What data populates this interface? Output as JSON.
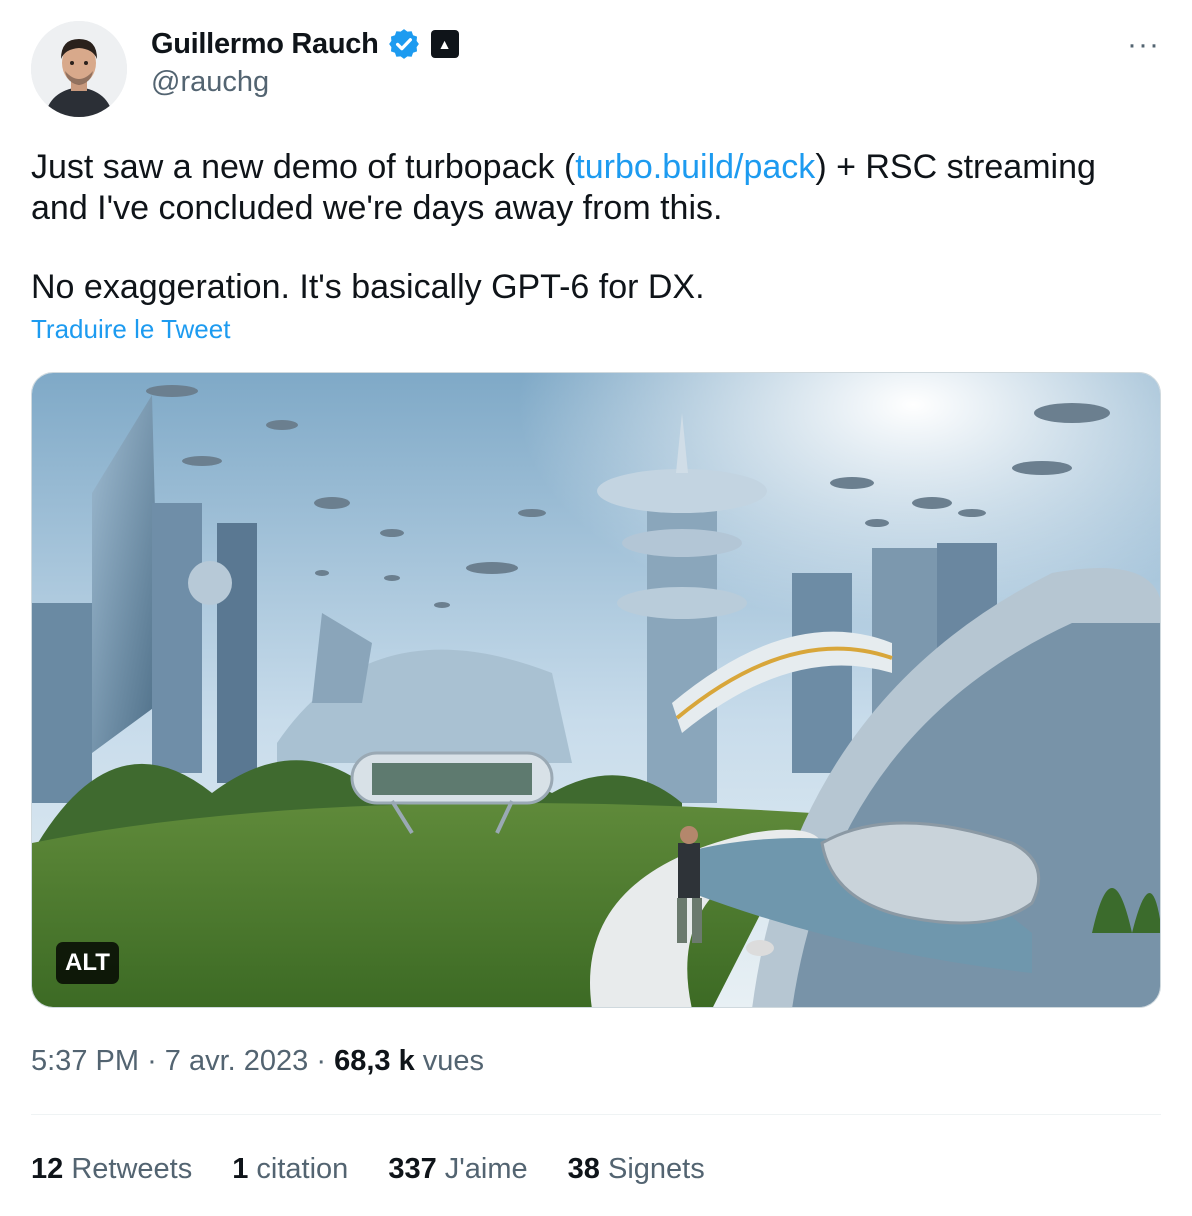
{
  "author": {
    "name": "Guillermo Rauch",
    "handle": "@rauchg",
    "verified_icon": "verified-badge-icon",
    "org_icon": "triangle-logo-icon"
  },
  "menu": {
    "more_label": "···"
  },
  "tweet": {
    "line1_pre": "Just saw a new demo of turbopack (",
    "link_text": "turbo.build/pack",
    "line1_post": ") + RSC streaming and I've concluded we're days away from this.",
    "line2": "No exaggeration. It's basically GPT-6 for DX.",
    "translate_label": "Traduire le Tweet"
  },
  "media": {
    "alt_label": "ALT",
    "subject": "futuristic city with flying vehicles, monorail and park"
  },
  "meta": {
    "time": "5:37 PM",
    "separator": "·",
    "date": "7 avr. 2023",
    "views_count": "68,3 k",
    "views_label": "vues"
  },
  "stats": [
    {
      "count": "12",
      "label": "Retweets"
    },
    {
      "count": "1",
      "label": "citation"
    },
    {
      "count": "337",
      "label": "J'aime"
    },
    {
      "count": "38",
      "label": "Signets"
    }
  ],
  "colors": {
    "text": "#0f1419",
    "secondary": "#536471",
    "link": "#1d9bf0",
    "divider": "#eff3f4"
  }
}
